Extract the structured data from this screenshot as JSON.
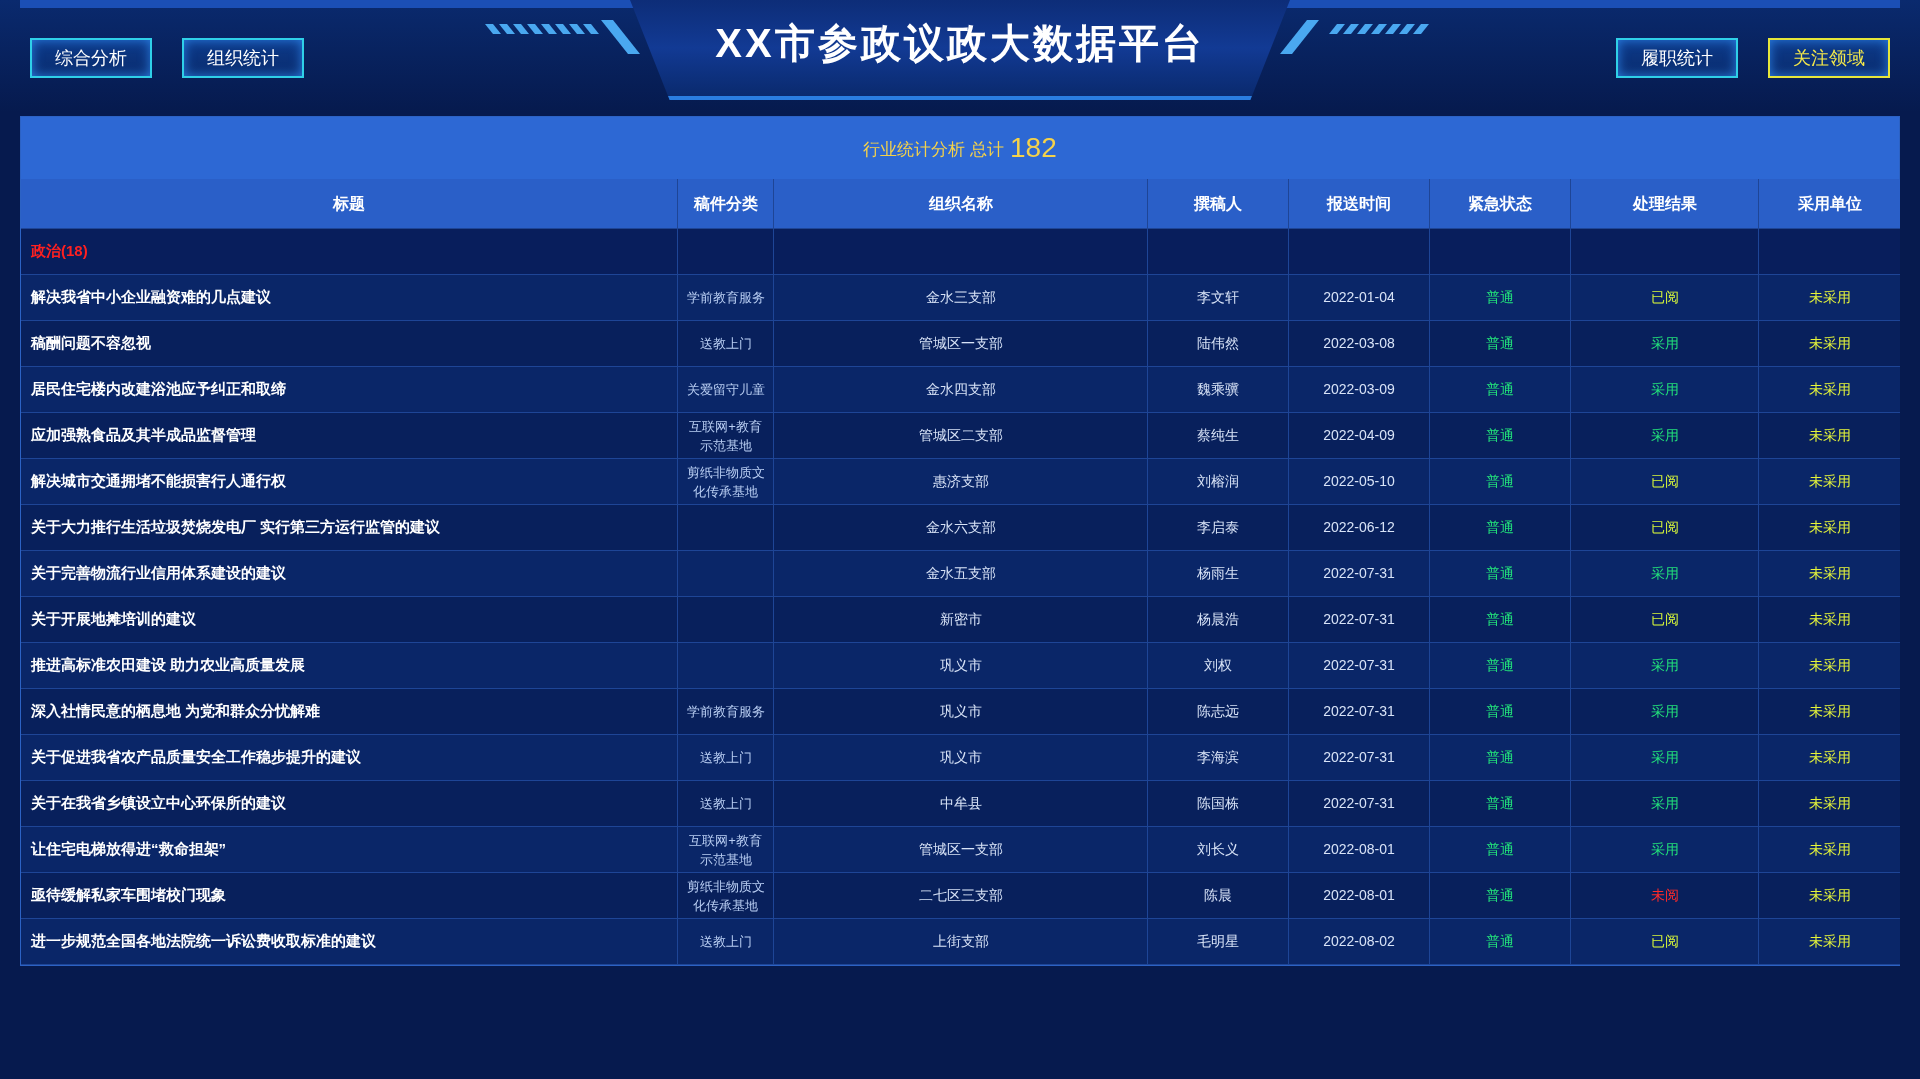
{
  "title": "XX市参政议政大数据平台",
  "nav_left": [
    {
      "label": "综合分析",
      "selected": false
    },
    {
      "label": "组织统计",
      "selected": false
    }
  ],
  "nav_right": [
    {
      "label": "履职统计",
      "selected": false
    },
    {
      "label": "关注领域",
      "selected": true
    }
  ],
  "table": {
    "caption": "行业统计分析 总计",
    "total": "182",
    "columns": [
      "标题",
      "稿件分类",
      "组织名称",
      "撰稿人",
      "报送时间",
      "紧急状态",
      "处理结果",
      "采用单位"
    ],
    "group": "政治(18)",
    "rows": [
      {
        "title": "解决我省中小企业融资难的几点建议",
        "category": "学前教育服务",
        "org": "金水三支部",
        "author": "李文轩",
        "date": "2022-01-04",
        "urgency": "普通",
        "result": {
          "text": "已阅",
          "color": "#d6f53a"
        },
        "adoption": "未采用"
      },
      {
        "title": "稿酬问题不容忽视",
        "category": "送教上门",
        "org": "管城区一支部",
        "author": "陆伟然",
        "date": "2022-03-08",
        "urgency": "普通",
        "result": {
          "text": "采用",
          "color": "#22e07a"
        },
        "adoption": "未采用"
      },
      {
        "title": "居民住宅楼内改建浴池应予纠正和取缔",
        "category": "关爱留守儿童",
        "org": "金水四支部",
        "author": "魏乘骥",
        "date": "2022-03-09",
        "urgency": "普通",
        "result": {
          "text": "采用",
          "color": "#22e07a"
        },
        "adoption": "未采用"
      },
      {
        "title": "应加强熟食品及其半成品监督管理",
        "category": "互联网+教育示范基地",
        "org": "管城区二支部",
        "author": "蔡纯生",
        "date": "2022-04-09",
        "urgency": "普通",
        "result": {
          "text": "采用",
          "color": "#22e07a"
        },
        "adoption": "未采用"
      },
      {
        "title": "解决城市交通拥堵不能损害行人通行权",
        "category": "剪纸非物质文化传承基地",
        "org": "惠济支部",
        "author": "刘榕润",
        "date": "2022-05-10",
        "urgency": "普通",
        "result": {
          "text": "已阅",
          "color": "#d6f53a"
        },
        "adoption": "未采用"
      },
      {
        "title": "关于大力推行生活垃圾焚烧发电厂 实行第三方运行监管的建议",
        "org": "金水六支部",
        "author": "李启泰",
        "date": "2022-06-12",
        "urgency": "普通",
        "result": {
          "text": "已阅",
          "color": "#d6f53a"
        },
        "adoption": "未采用"
      },
      {
        "title": "关于完善物流行业信用体系建设的建议",
        "org": "金水五支部",
        "author": "杨雨生",
        "date": "2022-07-31",
        "urgency": "普通",
        "result": {
          "text": "采用",
          "color": "#22e07a"
        },
        "adoption": "未采用"
      },
      {
        "title": "关于开展地摊培训的建议",
        "org": "新密市",
        "author": "杨晨浩",
        "date": "2022-07-31",
        "urgency": "普通",
        "result": {
          "text": "已阅",
          "color": "#d6f53a"
        },
        "adoption": "未采用"
      },
      {
        "title": "推进高标准农田建设 助力农业高质量发展",
        "org": "巩义市",
        "author": "刘权",
        "date": "2022-07-31",
        "urgency": "普通",
        "result": {
          "text": "采用",
          "color": "#22e07a"
        },
        "adoption": "未采用"
      },
      {
        "title": "深入社情民意的栖息地 为党和群众分忧解难",
        "category": "学前教育服务",
        "org": "巩义市",
        "author": "陈志远",
        "date": "2022-07-31",
        "urgency": "普通",
        "result": {
          "text": "采用",
          "color": "#22e07a"
        },
        "adoption": "未采用"
      },
      {
        "title": "关于促进我省农产品质量安全工作稳步提升的建议",
        "category": "送教上门",
        "org": "巩义市",
        "author": "李海滨",
        "date": "2022-07-31",
        "urgency": "普通",
        "result": {
          "text": "采用",
          "color": "#22e07a"
        },
        "adoption": "未采用"
      },
      {
        "title": "关于在我省乡镇设立中心环保所的建议",
        "category": "送教上门",
        "org": "中牟县",
        "author": "陈国栋",
        "date": "2022-07-31",
        "urgency": "普通",
        "result": {
          "text": "采用",
          "color": "#22e07a"
        },
        "adoption": "未采用"
      },
      {
        "title": "让住宅电梯放得进“救命担架”",
        "category": "互联网+教育示范基地",
        "org": "管城区一支部",
        "author": "刘长义",
        "date": "2022-08-01",
        "urgency": "普通",
        "result": {
          "text": "采用",
          "color": "#22e07a"
        },
        "adoption": "未采用"
      },
      {
        "title": "亟待缓解私家车围堵校门现象",
        "category": "剪纸非物质文化传承基地",
        "org": "二七区三支部",
        "author": "陈晨",
        "date": "2022-08-01",
        "urgency": "普通",
        "result": {
          "text": "未阅",
          "color": "#ff2a2a"
        },
        "adoption": "未采用"
      },
      {
        "title": "进一步规范全国各地法院统一诉讼费收取标准的建议",
        "category": "送教上门",
        "org": "上街支部",
        "author": "毛明星",
        "date": "2022-08-02",
        "urgency": "普通",
        "result": {
          "text": "已阅",
          "color": "#d6f53a"
        },
        "adoption": "未采用"
      }
    ]
  }
}
